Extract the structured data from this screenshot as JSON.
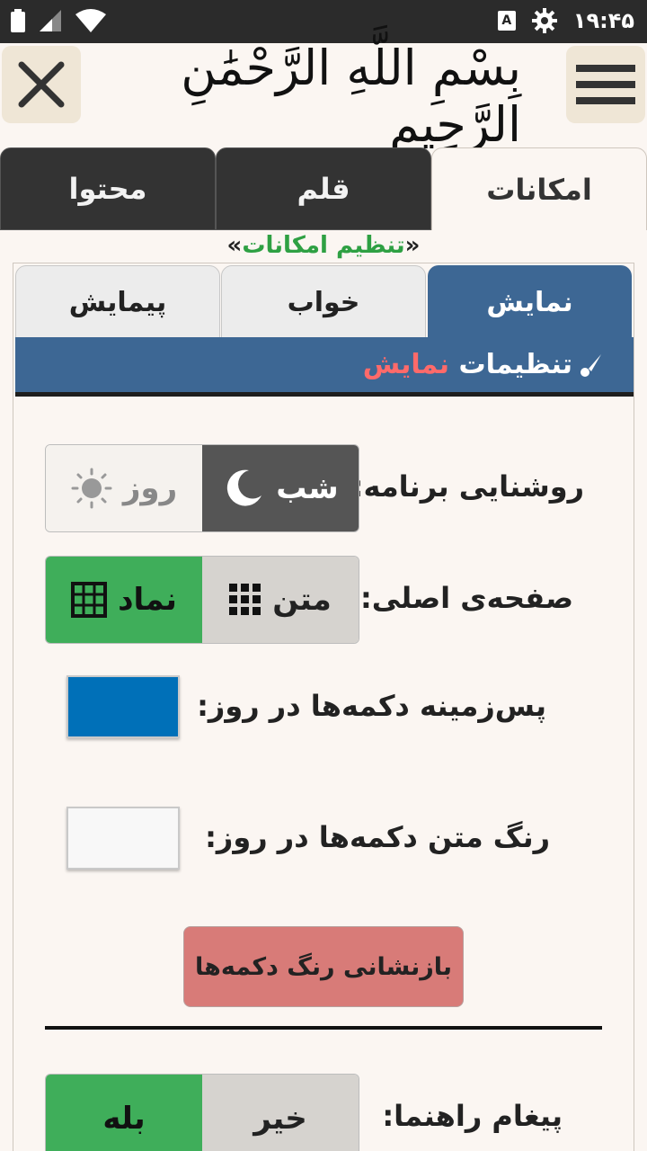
{
  "status_bar": {
    "time": "۱۹:۴۵",
    "a_badge": "A"
  },
  "header": {
    "basmala": "بِسْمِ اللَّهِ الرَّحْمَٰنِ الرَّحِيمِ"
  },
  "main_tabs": [
    {
      "label": "امکانات"
    },
    {
      "label": "قلم"
    },
    {
      "label": "محتوا"
    }
  ],
  "section_title": {
    "open": "«",
    "text": "تنظیم امکانات",
    "close": "»"
  },
  "sub_tabs": [
    {
      "label": "نمایش"
    },
    {
      "label": "خواب"
    },
    {
      "label": "پیمایش"
    }
  ],
  "sub_header": {
    "prefix": "تنظیمات ",
    "highlight": "نمایش"
  },
  "settings": {
    "brightness": {
      "label": "روشنایی برنامه:",
      "night": "شب",
      "day": "روز",
      "selected": "night"
    },
    "home_page": {
      "label": "صفحه‌ی اصلی:",
      "text": "متن",
      "symbol": "نماد",
      "selected": "symbol"
    },
    "button_bg_day": {
      "label": "پس‌زمینه دکمه‌ها در روز:",
      "color": "#0070b8"
    },
    "button_text_day": {
      "label": "رنگ متن دکمه‌ها در روز:",
      "color": "#f8f8f8"
    },
    "reset_button": "بازنشانی رنگ دکمه‌ها",
    "guide_message": {
      "label": "پیغام راهنما:",
      "no": "خیر",
      "yes": "بله",
      "selected": "yes"
    }
  },
  "colors": {
    "accent_blue": "#3d6794",
    "green": "#3fae5a",
    "reset_red": "#d87b78"
  }
}
